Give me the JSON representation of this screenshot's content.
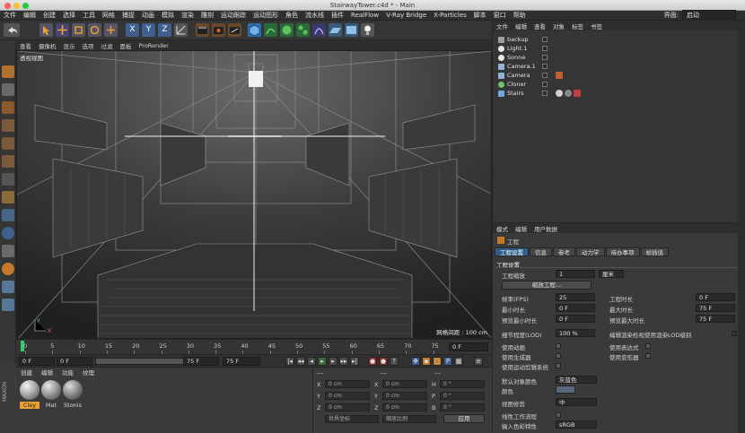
{
  "window": {
    "title": "StairwayTower.c4d * - Main"
  },
  "menubar": {
    "items": [
      "文件",
      "编辑",
      "创建",
      "选择",
      "工具",
      "网格",
      "捕捉",
      "动画",
      "模拟",
      "渲染",
      "雕刻",
      "运动跟踪",
      "运动图形",
      "角色",
      "流水线",
      "插件",
      "RealFlow",
      "V-Ray Bridge",
      "X-Particles",
      "脚本",
      "窗口",
      "帮助"
    ],
    "layout_label": "界面:",
    "layout_value": "启动"
  },
  "viewport": {
    "menu": [
      "查看",
      "摄像机",
      "显示",
      "选项",
      "过滤",
      "面板",
      "ProRender"
    ],
    "label": "透视视图",
    "grid_spacing": "网格间距 : 100 cm"
  },
  "timeline": {
    "ticks": [
      "0",
      "5",
      "10",
      "15",
      "20",
      "25",
      "30",
      "35",
      "40",
      "45",
      "50",
      "55",
      "60",
      "65",
      "70",
      "75"
    ],
    "end_frame": "0 F"
  },
  "transport": {
    "start": "0 F",
    "current": "0 F",
    "min_end": "75 F",
    "max_end": "75 F"
  },
  "materials": {
    "menu": [
      "创建",
      "编辑",
      "功能",
      "纹理"
    ],
    "items": [
      {
        "name": "Cley",
        "selected": true
      },
      {
        "name": "Mat",
        "selected": false
      },
      {
        "name": "Stonis",
        "selected": false
      }
    ]
  },
  "coordinates": {
    "header_left": "---",
    "header_mid": "---",
    "header_right": "---",
    "rows": [
      {
        "axis": "X",
        "pos": "0 cm",
        "axis2": "X",
        "size": "0 cm",
        "rot_axis": "H",
        "rot": "0 °"
      },
      {
        "axis": "Y",
        "pos": "0 cm",
        "axis2": "Y",
        "size": "0 cm",
        "rot_axis": "P",
        "rot": "0 °"
      },
      {
        "axis": "Z",
        "pos": "0 cm",
        "axis2": "Z",
        "size": "0 cm",
        "rot_axis": "B",
        "rot": "0 °"
      }
    ],
    "space": "世界坐标",
    "scale_mode": "缩放比例",
    "apply": "应用"
  },
  "objects": {
    "menu": [
      "文件",
      "编辑",
      "查看",
      "对象",
      "标签",
      "书签"
    ],
    "items": [
      {
        "name": "backup",
        "color": "#a0a0a0"
      },
      {
        "name": "Light.1",
        "color": "#e8e8e8"
      },
      {
        "name": "Sonne",
        "color": "#e8e8e8"
      },
      {
        "name": "Camera.1",
        "color": "#8fb3d9"
      },
      {
        "name": "Camera",
        "color": "#8fb3d9"
      },
      {
        "name": "Cloner",
        "color": "#6fc06f"
      },
      {
        "name": "Stairs",
        "color": "#6fa8dc"
      }
    ]
  },
  "attributes": {
    "menu": [
      "模式",
      "编辑",
      "用户数据"
    ],
    "section": "工程",
    "tabs": [
      "工程设置",
      "信息",
      "参考",
      "动力学",
      "待办事项",
      "帧插值"
    ],
    "group": "工程设置",
    "scale_label": "工程缩放",
    "scale_value": "1",
    "scale_unit": "厘米",
    "scale_button": "缩放工程...",
    "fps_label": "帧率(FPS)",
    "fps_value": "25",
    "duration_label": "工程时长",
    "duration_value": "0 F",
    "min_time_label": "最小时长",
    "min_time_value": "0 F",
    "max_time_label": "最大时长",
    "max_time_value": "75 F",
    "preview_min_label": "预览最小时长",
    "preview_min_value": "0 F",
    "preview_max_label": "预览最大时长",
    "preview_max_value": "75 F",
    "lod_label": "细节程度(LOD)",
    "lod_value": "100 %",
    "lod_render_label": "编辑渲染检视使用渲染LOD级别",
    "use_anim": "使用动画",
    "use_expr": "使用表达式",
    "use_gen": "使用生成器",
    "use_deform": "使用变形器",
    "use_motion": "使用运动剪辑系统",
    "default_color_label": "默认对象颜色",
    "default_color_value": "灰蓝色",
    "color_label": "颜色",
    "view_clip_label": "视图修剪",
    "view_clip_value": "中",
    "linear_label": "线性工作流程",
    "input_color_label": "输入色彩特性",
    "input_color_value": "sRGB"
  }
}
